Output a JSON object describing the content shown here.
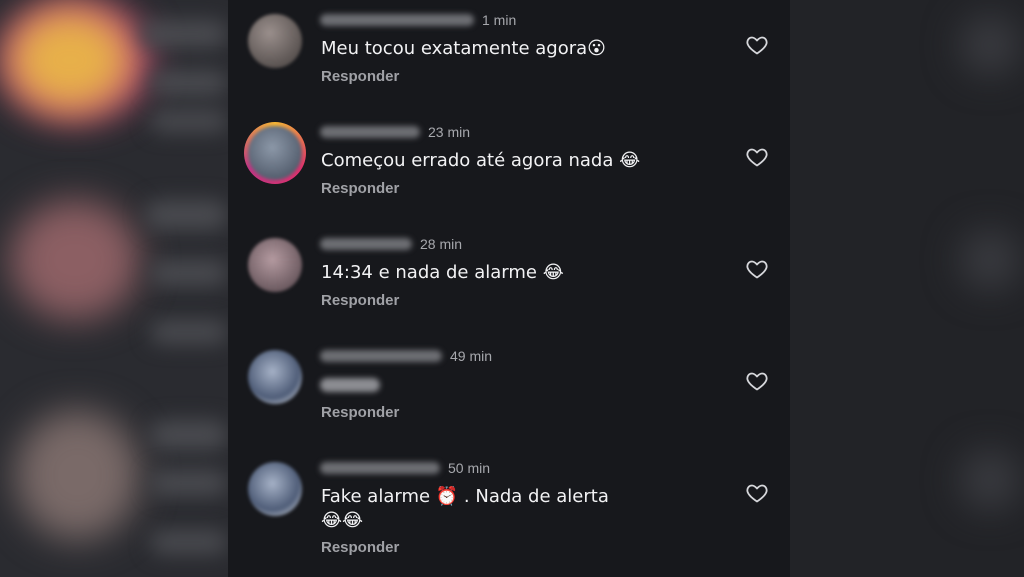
{
  "comments": [
    {
      "time": "1 min",
      "text": "Meu tocou exatamente agora😮",
      "reply": "Responder"
    },
    {
      "time": "23 min",
      "text": "Começou errado até agora nada 😂",
      "reply": "Responder"
    },
    {
      "time": "28 min",
      "text": "14:34 e nada de alarme 😂",
      "reply": "Responder"
    },
    {
      "time": "49 min",
      "text": "",
      "reply": "Responder"
    },
    {
      "time": "50 min",
      "text": "Fake alarme ⏰ . Nada de alerta",
      "text2": "😂😂",
      "reply": "Responder"
    }
  ],
  "icons": {
    "like": "heart-outline-icon"
  },
  "colors": {
    "background": "#17181c",
    "text": "#f2f2f4",
    "muted": "#a7a8ad",
    "story_ring": [
      "#f7b733",
      "#e1306c",
      "#c13584"
    ]
  }
}
